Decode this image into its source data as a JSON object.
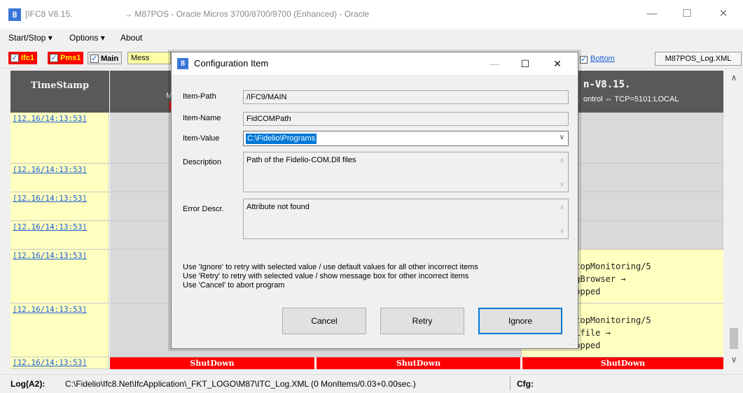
{
  "window": {
    "icon_text": "8",
    "title_left": "[IFC8 V8.15.",
    "title_main": "→ M87POS - Oracle Micros 3700/8700/9700 (Enhanced) - Oracle",
    "minimize": "—",
    "maximize": "☐",
    "close": "✕"
  },
  "menu": {
    "startstop": "Start/Stop ▾",
    "options": "Options ▾",
    "about": "About"
  },
  "toolbar": {
    "check": "✓",
    "ifc1": "Ifc1",
    "pms1": "Pms1",
    "main": "Main",
    "messages": "Mess",
    "bottom": "Bottom",
    "xml_file": "M87POS_Log.XML"
  },
  "grid": {
    "timestamp_header": "TimeStamp",
    "col2_header_top": "M87",
    "col2_header_bottom": "Li",
    "col4_header_top": "n-V8.15.",
    "col4_header_bottom": "ontrol ⇔ TCP=5101:LOCAL",
    "rows": [
      {
        "ts": "[12.16/14:13:53]"
      },
      {
        "ts": "[12.16/14:13:53]"
      },
      {
        "ts": "[12.16/14:13:53]"
      },
      {
        "ts": "[12.16/14:13:53]"
      },
      {
        "ts": "[12.16/14:13:53]",
        "msg": [
          "gHandler.StopMonitoring/5",
          "ngOutputLogBrowser →",
          " will be stopped"
        ]
      },
      {
        "ts": "[12.16/14:13:53]",
        "msg": [
          "gHandler.StopMonitoring/5",
          "ngOutputXMLfile →",
          " will be stopped"
        ]
      },
      {
        "ts": "[12.16/14:13:53]"
      }
    ],
    "shutdown": "ShutDown"
  },
  "scrollbar": {
    "up": "∧",
    "down": "∨"
  },
  "status": {
    "label": "Log(A2):",
    "path": "C:\\Fidelio\\Ifc8.Net\\IfcApplication\\_FKT_LOGO\\M87\\ITC_Log.XML (0 MonItems/0.03+0.00sec.)",
    "cfg": "Cfg:"
  },
  "dialog": {
    "icon_text": "8",
    "title": "Configuration Item",
    "minimize": "—",
    "maximize": "☐",
    "close": "✕",
    "item_path_label": "Item-Path",
    "item_path": "/IFC9/MAIN",
    "item_name_label": "Item-Name",
    "item_name": "FidCOMPath",
    "item_value_label": "Item-Value",
    "item_value": "C:\\Fidelio\\Programs",
    "description_label": "Description",
    "description": "Path of the Fidelio-COM.Dll files",
    "error_label": "Error Descr.",
    "error": "Attribute not found",
    "hint_ignore": "Use 'Ignore' to retry with selected value / use default values for all other incorrect items",
    "hint_retry": "Use 'Retry' to retry with selected value / show message box for other incorrect items",
    "hint_cancel": "Use 'Cancel' to abort program",
    "cancel_button": "Cancel",
    "retry_button": "Retry",
    "ignore_button": "Ignore",
    "combo_arrow": "∨",
    "memo_up": "∧",
    "memo_down": "∨"
  }
}
